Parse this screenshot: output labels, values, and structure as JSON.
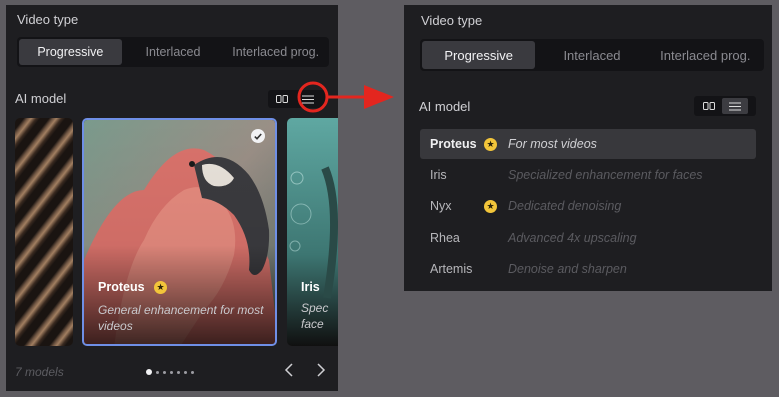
{
  "video_type": {
    "label": "Video type",
    "options": [
      "Progressive",
      "Interlaced",
      "Interlaced prog."
    ],
    "selected": "Progressive"
  },
  "ai_model": {
    "label": "AI model",
    "view_grid_icon": "grid-view-icon",
    "view_list_icon": "list-view-icon"
  },
  "carousel": {
    "cards": [
      {
        "name": "Proteus",
        "desc_line1": "General enhancement for most",
        "desc_line2": "videos",
        "recommended": true,
        "selected": true
      },
      {
        "name": "Iris",
        "desc_line1": "Spec",
        "desc_line2": "face"
      }
    ],
    "models_count": "7 models",
    "page_dots": 7,
    "active_dot": 0,
    "prev_icon": "chevron-left-icon",
    "next_icon": "chevron-right-icon"
  },
  "list": {
    "rows": [
      {
        "name": "Proteus",
        "desc": "For most videos",
        "recommended": true,
        "active": true
      },
      {
        "name": "Iris",
        "desc": "Specialized enhancement for faces",
        "recommended": false,
        "active": false
      },
      {
        "name": "Nyx",
        "desc": "Dedicated denoising",
        "recommended": true,
        "active": false
      },
      {
        "name": "Rhea",
        "desc": "Advanced 4x upscaling",
        "recommended": false,
        "active": false
      },
      {
        "name": "Artemis",
        "desc": "Denoise and sharpen",
        "recommended": false,
        "active": false
      }
    ]
  },
  "colors": {
    "page_bg": "#5e5c61",
    "panel_bg": "#1e1e21",
    "annotation_red": "#e3261f",
    "star_gold": "#f2c53a",
    "selected_border": "#6f8fe6"
  }
}
